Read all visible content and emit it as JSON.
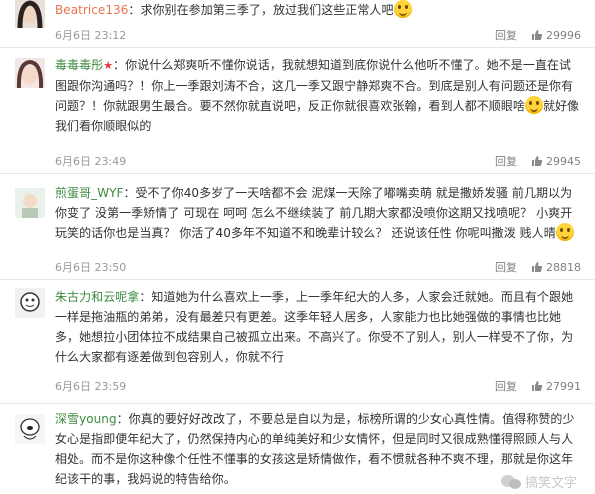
{
  "comments": [
    {
      "user": "Beatrice136",
      "text_main": "：求你别在参加第三季了，放过我们这些正常人吧",
      "text_after_emoji": "",
      "date": "6月6日",
      "time": "23:12",
      "reply_label": "回复",
      "likes": "29996"
    },
    {
      "user": "毒毒毒彤",
      "text_main": "：你说什么郑爽听不懂你说话，我就想知道到底你说什么他听不懂了。她不是一直在试图跟你沟通吗？！你上一季跟刘涛不合，这几一季又跟宁静郑爽不合。到底是别人有问题还是你有问题？！你就跟男生最合。要不然你就直说吧，反正你就很喜欢张翰，看到人都不顺眼啥",
      "text_after_emoji": "就好像我们看你顺眼似的",
      "date": "6月6日",
      "time": "23:49",
      "reply_label": "回复",
      "likes": "29945"
    },
    {
      "user": "煎蛋哥_WYF",
      "text_main": "：受不了你40多岁了一天啥都不会 泥煤一天除了嘟嘴卖萌 就是撒娇发骚 前几期以为你变了 没第一季矫情了 可现在 呵呵 怎么不继续装了 前几期大家都没喷你这期又找喷呢？ 小爽开玩笑的话你也是当真？ 你活了40多年不知道不和晚辈计较么？ 还说该任性 你呢叫撒泼 贱人晴",
      "text_after_emoji": "",
      "date": "6月6日",
      "time": "23:50",
      "reply_label": "回复",
      "likes": "28818"
    },
    {
      "user": "朱古力和云呢拿",
      "text_main": "：知道她为什么喜欢上一季，上一季年纪大的人多，人家会迁就她。而且有个跟她一样是拖油瓶的弟弟，没有最差只有更差。这季年轻人居多，人家能力也比她强做的事情也比她多，她想拉小团体拉不成结果自己被孤立出来。不高兴了。你受不了别人，别人一样受不了你，为什么大家都有逐差做到包容别人，你就不行",
      "text_after_emoji": "",
      "date": "6月6日",
      "time": "23:59",
      "reply_label": "回复",
      "likes": "27991"
    },
    {
      "user": "深雪young",
      "text_main": "：你真的要好好改改了，不要总是自以为是，标榜所谓的少女心真性情。值得称赞的少女心是指即便年纪大了，仍然保持内心的单纯美好和少女情怀，但是同时又很成熟懂得照顾人与人相处。而不是你这种像个任性不懂事的女孩这是矫情做作，看不惯就各种不爽不理，那就是你这年纪该干的事，我妈说的特告给你。",
      "text_after_emoji": "",
      "date": "",
      "time": "",
      "reply_label": "",
      "likes": ""
    }
  ],
  "watermark": "搞笑文字"
}
